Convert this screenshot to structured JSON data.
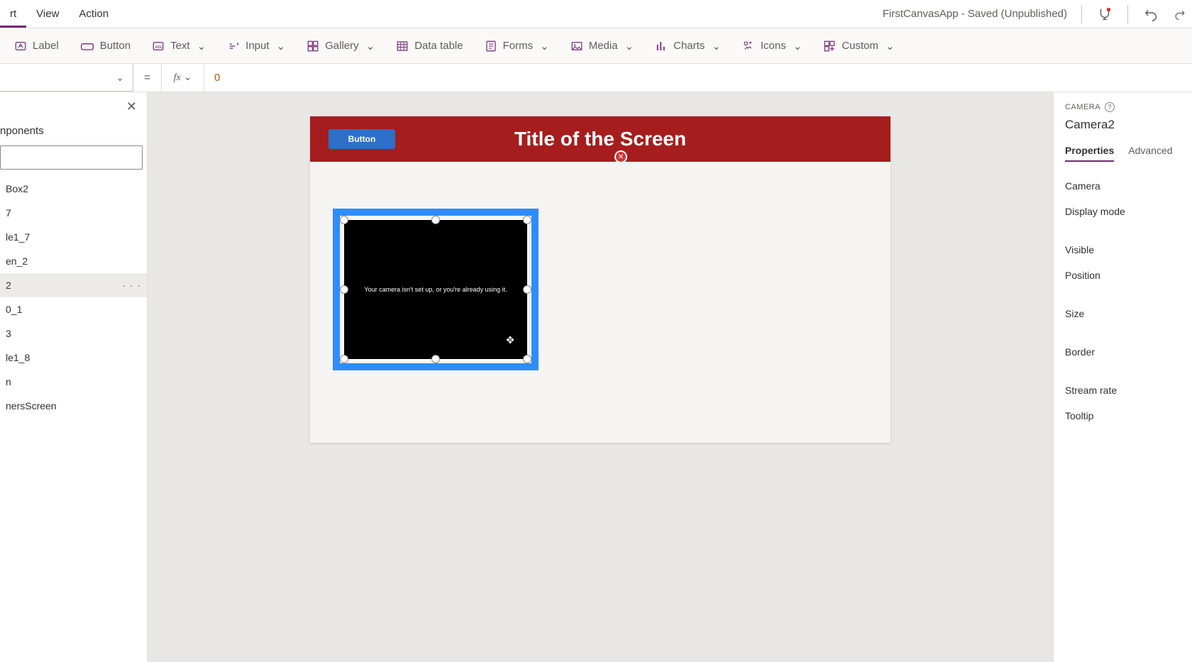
{
  "menus": {
    "insert": "rt",
    "view": "View",
    "action": "Action"
  },
  "appTitle": "FirstCanvasApp - Saved (Unpublished)",
  "ribbon": {
    "label": "Label",
    "button": "Button",
    "text": "Text",
    "input": "Input",
    "gallery": "Gallery",
    "dataTable": "Data table",
    "forms": "Forms",
    "media": "Media",
    "charts": "Charts",
    "icons": "Icons",
    "custom": "Custom"
  },
  "formula": {
    "equals": "=",
    "fx": "fx",
    "value": "0"
  },
  "tree": {
    "tabLabel": "nponents",
    "items": [
      "Box2",
      "7",
      "le1_7",
      "en_2",
      "2",
      "0_1",
      "3",
      "le1_8",
      "n",
      "nersScreen"
    ],
    "selectedIndex": 4
  },
  "canvas": {
    "buttonLabel": "Button",
    "title": "Title of the Screen",
    "cameraMsg": "Your camera isn't set up, or you're already using it.",
    "moveGlyph": "✥"
  },
  "props": {
    "type": "CAMERA",
    "name": "Camera2",
    "tabs": {
      "properties": "Properties",
      "advanced": "Advanced"
    },
    "rows": [
      "Camera",
      "Display mode",
      "Visible",
      "Position",
      "Size",
      "Border",
      "Stream rate",
      "Tooltip"
    ]
  }
}
